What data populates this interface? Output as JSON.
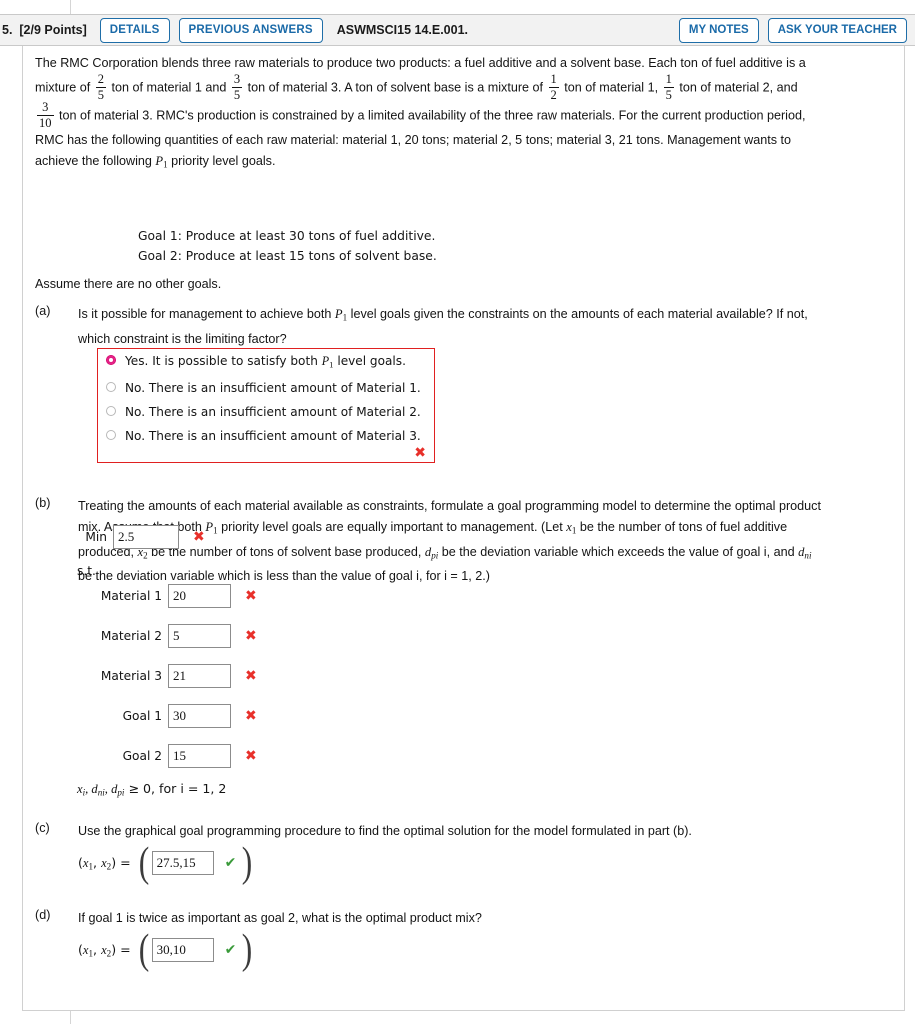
{
  "header": {
    "question_number": "5.",
    "points": "[2/9 Points]",
    "details_label": "DETAILS",
    "previous_answers_label": "PREVIOUS ANSWERS",
    "assignment_code": "ASWMSCI15 14.E.001.",
    "my_notes_label": "MY NOTES",
    "ask_teacher_label": "ASK YOUR TEACHER",
    "button_color": "#1a6aa8"
  },
  "problem": {
    "l1": "The RMC Corporation blends three raw materials to produce two products: a fuel additive and a solvent base. Each ton of fuel additive is a",
    "l2a": "mixture of",
    "f1": {
      "num": "2",
      "den": "5"
    },
    "l2b": "ton of material 1 and",
    "f2": {
      "num": "3",
      "den": "5"
    },
    "l2c": "ton of material 3. A ton of solvent base is a mixture of",
    "f3": {
      "num": "1",
      "den": "2"
    },
    "l2d": "ton of material 1,",
    "f4": {
      "num": "1",
      "den": "5"
    },
    "l2e": "ton of material 2, and",
    "f5": {
      "num": "3",
      "den": "10"
    },
    "l3b": "ton of material 3. RMC's production is constrained by a limited availability of the three raw materials. For the current production period,",
    "l4": "RMC has the following quantities of each raw material: material 1, 20 tons; material 2, 5 tons; material 3, 21 tons. Management wants to",
    "l5a": "achieve the following",
    "l5_p": "P",
    "l5_sub": "1",
    "l5b": "priority level goals.",
    "goal1": "Goal 1: Produce at least 30 tons of fuel additive.",
    "goal2": "Goal 2: Produce at least 15 tons of solvent base.",
    "assume": "Assume there are no other goals."
  },
  "part_a": {
    "letter": "(a)",
    "q1a": "Is it possible for management to achieve both",
    "q1_p": "P",
    "q1_sub": "1",
    "q1b": "level goals given the constraints on the amounts of each material available? If not,",
    "q2": "which constraint is the limiting factor?",
    "choices": [
      {
        "text_a": "Yes. It is possible to satisfy both",
        "p": "P",
        "sub": "1",
        "text_b": "level goals.",
        "selected": true
      },
      {
        "text_a": "No. There is an insufficient amount of Material 1.",
        "selected": false
      },
      {
        "text_a": "No. There is an insufficient amount of Material 2.",
        "selected": false
      },
      {
        "text_a": "No. There is an insufficient amount of Material 3.",
        "selected": false
      }
    ],
    "mark": "✖",
    "mark_color": "#e8302a",
    "box_border_color": "#e02020"
  },
  "part_b": {
    "letter": "(b)",
    "l1": "Treating the amounts of each material available as constraints, formulate a goal programming model to determine the optimal product",
    "l2a": "mix. Assume that both",
    "l2_p": "P",
    "l2_sub": "1",
    "l2b": "priority level goals are equally important to management. (Let",
    "l2_x": "x",
    "l2_xsub": "1",
    "l2c": "be the number of tons of fuel additive",
    "l3a": "produced,",
    "l3_x": "x",
    "l3_xsub": "2",
    "l3b": "be the number of tons of solvent base produced,",
    "l3_d": "d",
    "l3_dsub": "pi",
    "l3c": "be the deviation variable which exceeds the value of goal i, and",
    "l3_d2": "d",
    "l3_d2sub": "ni",
    "l4": "be the deviation variable which is less than the value of goal i, for i = 1, 2.)",
    "min_label": "Min",
    "min_value": "2.5",
    "st_label": "s.t.",
    "constraints": [
      {
        "label": "Material 1",
        "value": "20",
        "mark": "✖"
      },
      {
        "label": "Material 2",
        "value": "5",
        "mark": "✖"
      },
      {
        "label": "Material 3",
        "value": "21",
        "mark": "✖"
      },
      {
        "label": "Goal 1",
        "value": "30",
        "mark": "✖"
      },
      {
        "label": "Goal 2",
        "value": "15",
        "mark": "✖"
      }
    ],
    "min_mark": "✖",
    "nonneg_x": "x",
    "nonneg_xsub": "i",
    "nonneg_mid": ", d",
    "nonneg_dn": "ni",
    "nonneg_mid2": ", d",
    "nonneg_dp": "pi",
    "nonneg_tail": " ≥ 0, for i = 1, 2"
  },
  "part_c": {
    "letter": "(c)",
    "prompt": "Use the graphical goal programming procedure to find the optimal solution for the model formulated in part (b).",
    "lhs_x": "x",
    "lhs_sub1": "1",
    "lhs_sub2": "2",
    "value": "27.5,15",
    "mark": "✔",
    "mark_color": "#3a9a3a"
  },
  "part_d": {
    "letter": "(d)",
    "prompt": "If goal 1 is twice as important as goal 2, what is the optimal product mix?",
    "value": "30,10",
    "mark": "✔",
    "mark_color": "#3a9a3a"
  }
}
